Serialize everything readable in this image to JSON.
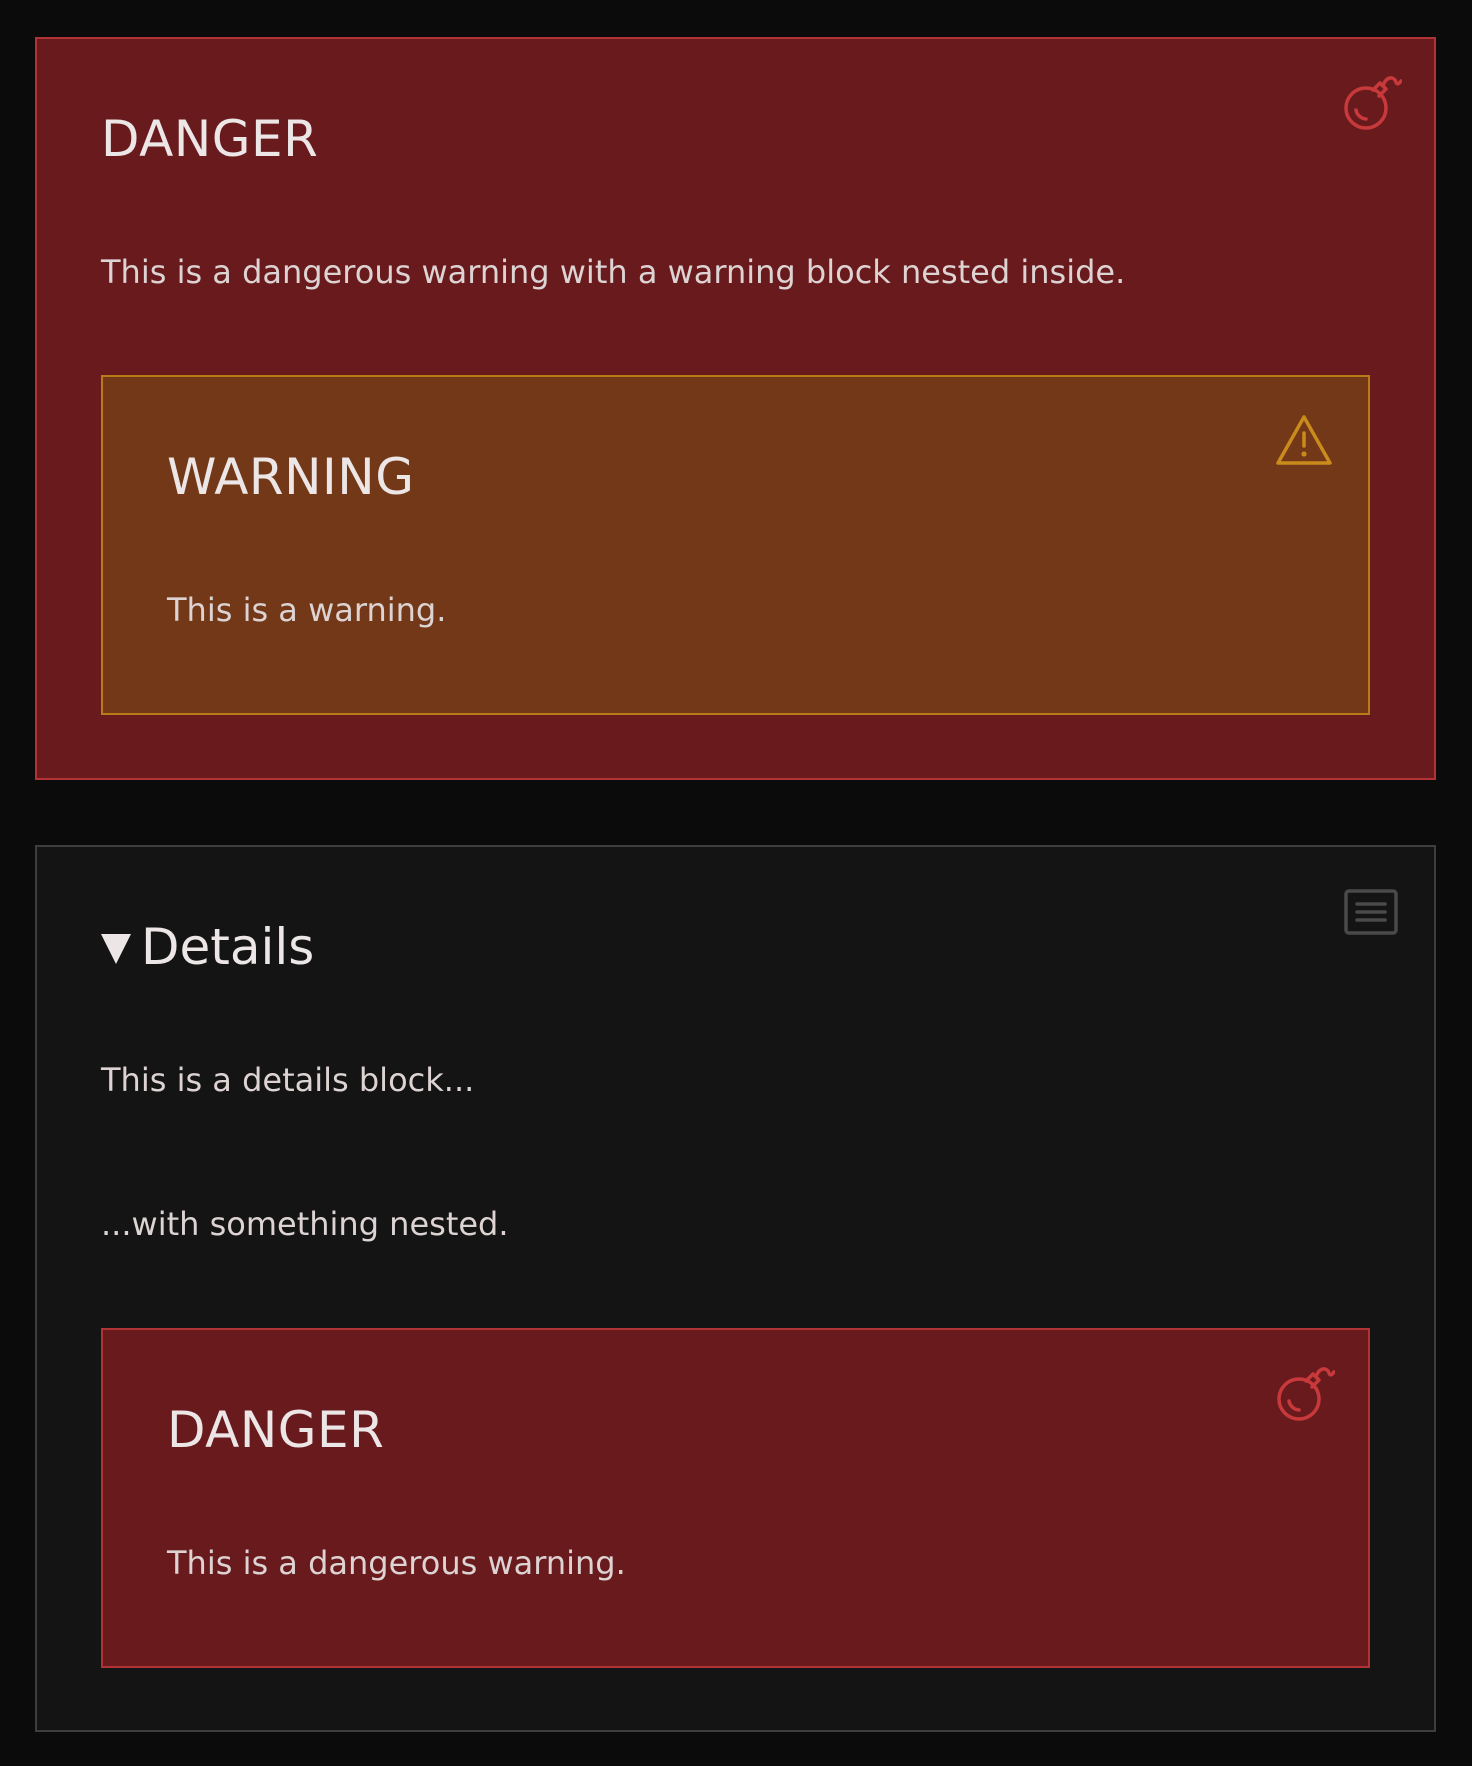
{
  "outer_danger": {
    "title": "DANGER",
    "body": "This is a dangerous warning with a warning block nested inside.",
    "icon": "bomb-icon",
    "nested_warning": {
      "title": "WARNING",
      "body": "This is a warning.",
      "icon": "warning-triangle-icon"
    }
  },
  "details": {
    "summary": "Details",
    "icon": "details-list-icon",
    "paragraphs": [
      "This is a details block...",
      "...with something nested."
    ],
    "nested_danger": {
      "title": "DANGER",
      "body": "This is a dangerous warning.",
      "icon": "bomb-icon"
    }
  },
  "colors": {
    "danger_bg": "#681a1d",
    "danger_border": "#b23336",
    "danger_icon": "#c8393c",
    "warning_bg": "#733817",
    "warning_border": "#b97b16",
    "warning_icon": "#c98b1c",
    "details_bg": "#141414",
    "details_border": "#3e3e3e"
  }
}
